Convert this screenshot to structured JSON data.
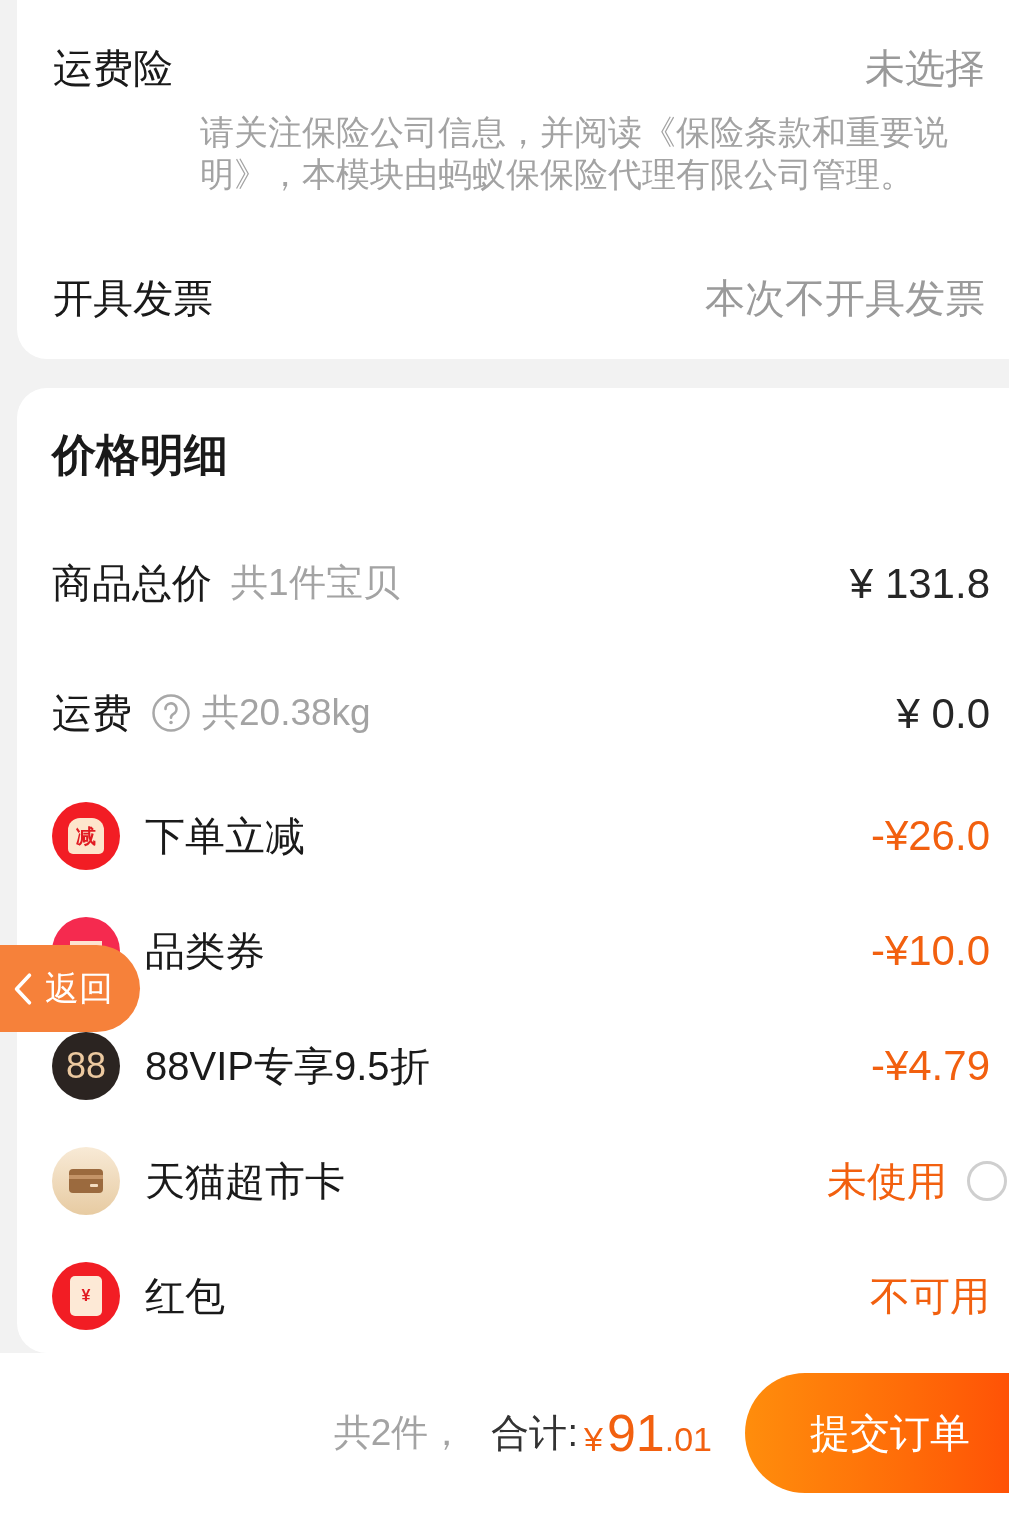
{
  "order_options": {
    "rows": [
      {
        "kind": "option",
        "label": "运费险",
        "value": "未选择",
        "note": "请关注保险公司信息，并阅读《保险条款和重要说明》，本模块由蚂蚁保保险代理有限公司管理。"
      },
      {
        "kind": "option",
        "label": "开具发票",
        "value": "本次不开具发票"
      }
    ]
  },
  "price_details": {
    "title": "价格明细",
    "rows": [
      {
        "kind": "goods_total",
        "label": "商品总价",
        "detail": "共1件宝贝",
        "amount": "¥ 131.8"
      },
      {
        "kind": "shipping_fee",
        "label": "运费",
        "help": true,
        "detail": "共20.38kg",
        "amount": "¥ 0.0"
      },
      {
        "kind": "instant_discount",
        "icon_text": "减",
        "label": "下单立减",
        "amount": "-¥26.0"
      },
      {
        "kind": "category_coupon",
        "label": "品类券",
        "amount": "-¥10.0"
      },
      {
        "kind": "vip_discount",
        "icon_text": "88",
        "label": "88VIP专享9.5折",
        "amount": "-¥4.79"
      },
      {
        "kind": "store_card",
        "label": "天猫超市卡",
        "status": "未使用",
        "checked": false
      },
      {
        "kind": "red_packet",
        "icon_text": "¥",
        "label": "红包",
        "status": "不可用"
      }
    ]
  },
  "back_button": {
    "label": "返回"
  },
  "footer": {
    "count": "共2件，",
    "total_label": "合计:",
    "total": {
      "currency": "¥",
      "integer": "91",
      "decimal": ".01"
    },
    "submit": "提交订单"
  }
}
